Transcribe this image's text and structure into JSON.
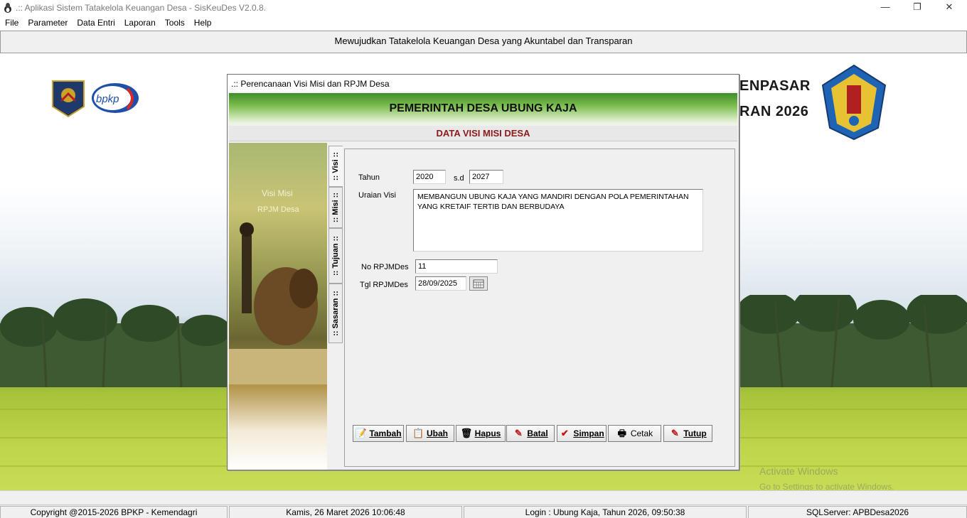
{
  "window": {
    "title": ".:: Aplikasi Sistem Tatakelola Keuangan Desa - SisKeuDes V2.0.8.",
    "minimize": "—",
    "maximize": "❐",
    "close": "✕"
  },
  "menu": [
    "File",
    "Parameter",
    "Data Entri",
    "Laporan",
    "Tools",
    "Help"
  ],
  "banner": "Mewujudkan Tatakelola Keuangan Desa yang Akuntabel dan Transparan",
  "background": {
    "header_line1": "ENPASAR",
    "header_line2": "RAN 2026",
    "bpkp_logo_text": "bpkp",
    "watermark_line1": "Activate Windows",
    "watermark_line2": "Go to Settings to activate Windows."
  },
  "dialog": {
    "title": ".:: Perencanaan Visi Misi dan RPJM Desa",
    "banner": "PEMERINTAH DESA UBUNG KAJA",
    "subtitle": "DATA VISI MISI DESA",
    "side_text1": "Visi Misi",
    "side_text2": "RPJM Desa",
    "tabs": [
      ":: Visi ::",
      ":: Misi ::",
      ":: Tujuan ::",
      ":: Sasaran ::"
    ],
    "form": {
      "tahun_label": "Tahun",
      "tahun_from": "2020",
      "sd_label": "s.d",
      "tahun_to": "2027",
      "uraian_label": "Uraian Visi",
      "uraian_value": "MEMBANGUN UBUNG KAJA YANG MANDIRI DENGAN POLA PEMERINTAHAN YANG KRETAIF TERTIB DAN BERBUDAYA",
      "no_label": "No RPJMDes",
      "no_value": "11",
      "tgl_label": "Tgl RPJMDes",
      "tgl_value": "28/09/2025"
    },
    "buttons": {
      "tambah": "Tambah",
      "ubah": "Ubah",
      "hapus": "Hapus",
      "batal": "Batal",
      "simpan": "Simpan",
      "cetak": "Cetak",
      "tutup": "Tutup"
    }
  },
  "status": {
    "copyright": "Copyright @2015-2026 BPKP - Kemendagri",
    "datetime": "Kamis, 26 Maret 2026  10:06:48",
    "login": "Login : Ubung Kaja,  Tahun 2026, 09:50:38",
    "server": "SQLServer: APBDesa2026"
  }
}
